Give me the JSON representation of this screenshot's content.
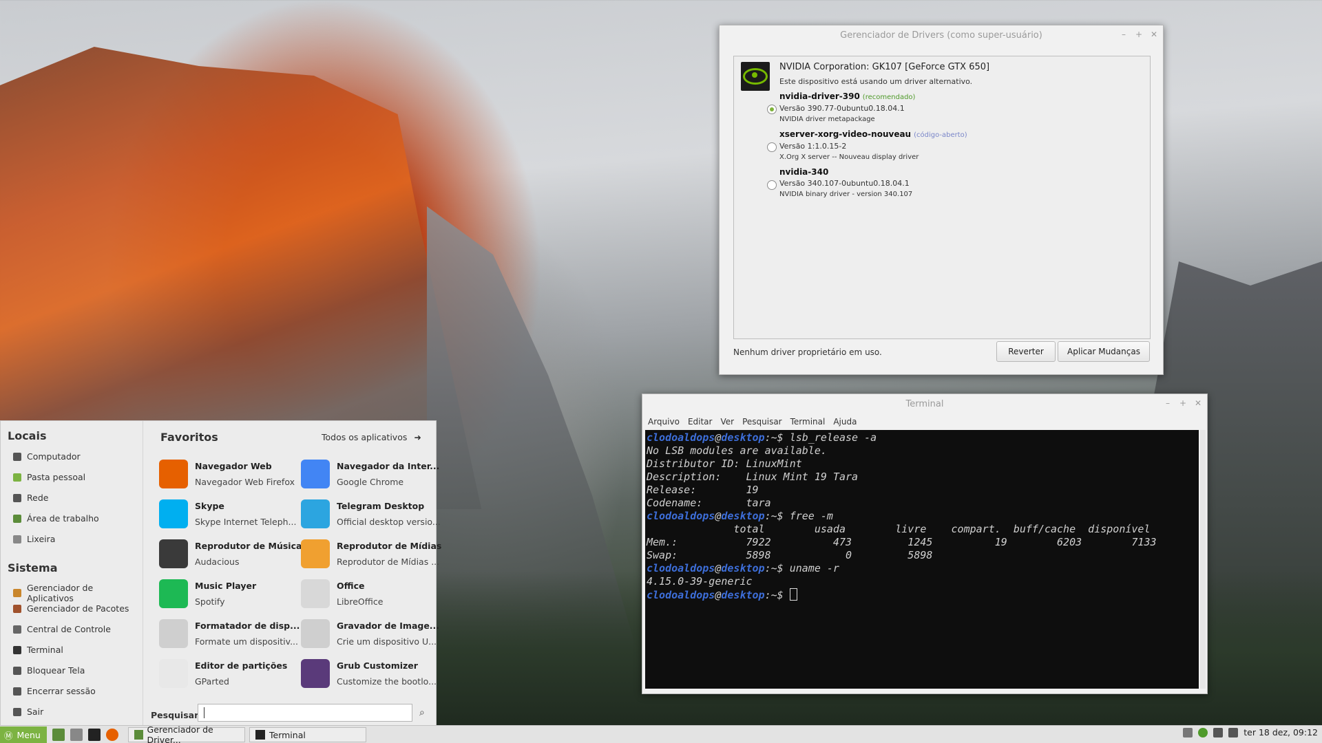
{
  "driver_manager": {
    "title": "Gerenciador de Drivers (como super-usuário)",
    "device_name": "NVIDIA Corporation: GK107 [GeForce GTX 650]",
    "device_status": "Este dispositivo está usando um driver alternativo.",
    "options": [
      {
        "name": "nvidia-driver-390",
        "tag": "(recomendado)",
        "tag_color": "#4f9a2a",
        "version": "Versão 390.77-0ubuntu0.18.04.1",
        "desc": "NVIDIA driver metapackage",
        "selected": true
      },
      {
        "name": "xserver-xorg-video-nouveau",
        "tag": "(código-aberto)",
        "tag_color": "#7a86c9",
        "version": "Versão 1:1.0.15-2",
        "desc": "X.Org X server -- Nouveau display driver",
        "selected": false
      },
      {
        "name": "nvidia-340",
        "tag": "",
        "tag_color": "",
        "version": "Versão 340.107-0ubuntu0.18.04.1",
        "desc": "NVIDIA binary driver - version 340.107",
        "selected": false
      }
    ],
    "footer_text": "Nenhum driver proprietário em uso.",
    "revert_label": "Reverter",
    "apply_label": "Aplicar Mudanças"
  },
  "terminal": {
    "title": "Terminal",
    "menu": [
      "Arquivo",
      "Editar",
      "Ver",
      "Pesquisar",
      "Terminal",
      "Ajuda"
    ],
    "prompt_user": "clodoaldops",
    "prompt_host": "desktop",
    "prompt_suffix": ":~$ ",
    "lines": [
      {
        "prompt": true,
        "text": "lsb_release -a"
      },
      {
        "prompt": false,
        "text": "No LSB modules are available."
      },
      {
        "prompt": false,
        "text": "Distributor ID: LinuxMint"
      },
      {
        "prompt": false,
        "text": "Description:    Linux Mint 19 Tara"
      },
      {
        "prompt": false,
        "text": "Release:        19"
      },
      {
        "prompt": false,
        "text": "Codename:       tara"
      },
      {
        "prompt": true,
        "text": "free -m"
      },
      {
        "prompt": false,
        "text": "              total        usada        livre    compart.  buff/cache  disponível"
      },
      {
        "prompt": false,
        "text": "Mem.:           7922          473         1245          19        6203        7133"
      },
      {
        "prompt": false,
        "text": "Swap:           5898            0         5898"
      },
      {
        "prompt": true,
        "text": "uname -r"
      },
      {
        "prompt": false,
        "text": "4.15.0-39-generic"
      },
      {
        "prompt": true,
        "text": "",
        "cursor": true
      }
    ]
  },
  "menu": {
    "places_title": "Locais",
    "places": [
      {
        "label": "Computador",
        "icon": "computer-icon",
        "color": "#555"
      },
      {
        "label": "Pasta pessoal",
        "icon": "home-folder-icon",
        "color": "#7cb342"
      },
      {
        "label": "Rede",
        "icon": "network-icon",
        "color": "#555"
      },
      {
        "label": "Área de trabalho",
        "icon": "desktop-icon",
        "color": "#5b8c3a"
      },
      {
        "label": "Lixeira",
        "icon": "trash-icon",
        "color": "#888"
      }
    ],
    "system_title": "Sistema",
    "system": [
      {
        "label": "Gerenciador de Aplicativos",
        "icon": "software-manager-icon",
        "color": "#c9862c"
      },
      {
        "label": "Gerenciador de Pacotes",
        "icon": "package-manager-icon",
        "color": "#a0522d"
      },
      {
        "label": "Central de Controle",
        "icon": "control-center-icon",
        "color": "#666"
      },
      {
        "label": "Terminal",
        "icon": "terminal-icon",
        "color": "#333"
      },
      {
        "label": "Bloquear Tela",
        "icon": "lock-icon",
        "color": "#555"
      },
      {
        "label": "Encerrar sessão",
        "icon": "logout-icon",
        "color": "#555"
      },
      {
        "label": "Sair",
        "icon": "power-icon",
        "color": "#555"
      }
    ],
    "favorites_title": "Favoritos",
    "all_apps_label": "Todos os aplicativos",
    "apps": [
      {
        "name": "Navegador Web",
        "sub": "Navegador Web Firefox",
        "icon": "firefox-icon",
        "color": "#e66000"
      },
      {
        "name": "Navegador da Inter...",
        "sub": "Google Chrome",
        "icon": "chrome-icon",
        "color": "#4285f4"
      },
      {
        "name": "Skype",
        "sub": "Skype Internet Teleph...",
        "icon": "skype-icon",
        "color": "#00aff0"
      },
      {
        "name": "Telegram Desktop",
        "sub": "Official desktop versio...",
        "icon": "telegram-icon",
        "color": "#2ca5e0"
      },
      {
        "name": "Reprodutor de Música",
        "sub": "Audacious",
        "icon": "audacious-icon",
        "color": "#3a3a3a"
      },
      {
        "name": "Reprodutor de Mídias",
        "sub": "Reprodutor de Mídias ...",
        "icon": "media-player-icon",
        "color": "#f0a030"
      },
      {
        "name": "Music Player",
        "sub": "Spotify",
        "icon": "spotify-icon",
        "color": "#1db954"
      },
      {
        "name": "Office",
        "sub": "LibreOffice",
        "icon": "office-icon",
        "color": "#d8d8d8"
      },
      {
        "name": "Formatador de disp...",
        "sub": "Formate um dispositiv...",
        "icon": "usb-format-icon",
        "color": "#cfcfcf"
      },
      {
        "name": "Gravador de Image...",
        "sub": "Crie um dispositivo U...",
        "icon": "usb-writer-icon",
        "color": "#cfcfcf"
      },
      {
        "name": "Editor de partições",
        "sub": "GParted",
        "icon": "gparted-icon",
        "color": "#e8e8e8"
      },
      {
        "name": "Grub Customizer",
        "sub": "Customize the bootlo...",
        "icon": "grub-icon",
        "color": "#5a3a7a"
      }
    ],
    "search_label": "Pesquisar:",
    "search_value": ""
  },
  "taskbar": {
    "menu_label": "Menu",
    "windows": [
      "Gerenciador de Driver...",
      "Terminal"
    ],
    "clock": "ter 18 dez, 09:12"
  }
}
